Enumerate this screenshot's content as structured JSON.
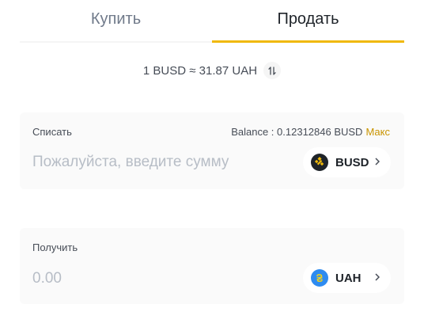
{
  "tabs": [
    {
      "label": "Купить",
      "active": false
    },
    {
      "label": "Продать",
      "active": true
    }
  ],
  "rate": {
    "text": "1 BUSD ≈ 31.87 UAH",
    "swap_icon": "swap-vertical-icon"
  },
  "sell": {
    "label": "Списать",
    "balance_text": "Balance : 0.12312846 BUSD",
    "max_label": "Макс",
    "placeholder": "Пожалуйста, введите сумму",
    "value": "",
    "coin": {
      "symbol": "BUSD",
      "icon": "busd-coin-icon",
      "color": "#1e2329"
    }
  },
  "buy": {
    "label": "Получить",
    "placeholder": "0.00",
    "value": "",
    "coin": {
      "symbol": "UAH",
      "icon": "uah-coin-icon",
      "color": "#2e8bf0"
    }
  },
  "colors": {
    "accent": "#f0b90b",
    "max_link": "#c99400",
    "card_bg": "#fafafa"
  }
}
